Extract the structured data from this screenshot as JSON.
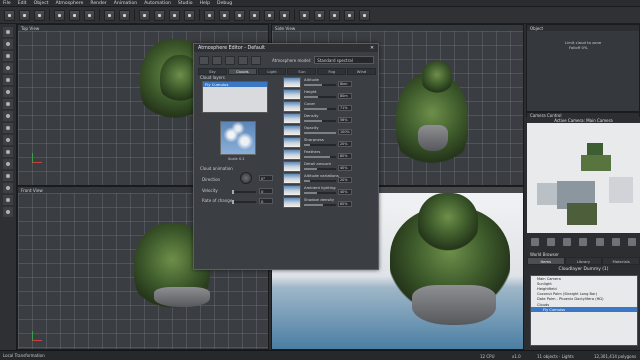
{
  "menu": [
    "File",
    "Edit",
    "Object",
    "Atmosphere",
    "Render",
    "Animation",
    "Automation",
    "Studio",
    "Help",
    "Debug"
  ],
  "viewports": {
    "top": "Top View",
    "side": "Side View",
    "front": "Front View",
    "main_info": "GeForce GTX 1070/PCIe/SSE2 (0) ▸ 4a"
  },
  "atmosphere_editor": {
    "title": "Atmosphere Editor - Default",
    "close": "✕",
    "model_label": "Atmosphere model:",
    "model_value": "Standard spectral",
    "tabs": [
      "Sky",
      "Clouds",
      "Light",
      "Sun",
      "Fog",
      "Wind"
    ],
    "active_tab": "Clouds",
    "cloud_layers_label": "Cloud layers",
    "layer_item": "Fly Cumulus",
    "scale_label": "Scale",
    "scale_value": "0.2",
    "cloud_animation_label": "Cloud animation",
    "direction_label": "Direction",
    "direction_value": "0°",
    "velocity_label": "Velocity",
    "velocity_value": "0",
    "rate_label": "Rate of change",
    "rate_value": "0",
    "params": [
      {
        "label": "Altitude",
        "value": "8km",
        "fill": 0.55
      },
      {
        "label": "Height",
        "value": "80m",
        "fill": 0.45
      },
      {
        "label": "Cover",
        "value": "71%",
        "fill": 0.71
      },
      {
        "label": "Density",
        "value": "56%",
        "fill": 0.56
      },
      {
        "label": "Opacity",
        "value": "100%",
        "fill": 1.0
      },
      {
        "label": "Sharpness",
        "value": "20%",
        "fill": 0.2
      },
      {
        "label": "Feathers",
        "value": "80%",
        "fill": 0.8
      },
      {
        "label": "Detail amount",
        "value": "40%",
        "fill": 0.4
      },
      {
        "label": "Altitude variations",
        "value": "20%",
        "fill": 0.2
      },
      {
        "label": "Ambient lighting",
        "value": "40%",
        "fill": 0.4
      },
      {
        "label": "Shadow density",
        "value": "60%",
        "fill": 0.6
      }
    ]
  },
  "right_panel": {
    "object_title": "Object",
    "limit_cloud": "Limit cloud to zone",
    "falloff_label": "Falloff",
    "falloff_value": "0%",
    "camera_control": "Camera Control",
    "camera_title": "Active Camera: Main Camera",
    "world_browser": "World Browser",
    "wb_tabs": [
      "Items",
      "Library",
      "Materials"
    ],
    "wb_active": "Items",
    "wb_scene": "Cloudlayer Dummy (1)",
    "tree": [
      "Main Camera",
      "Sunlight",
      "Heightfield",
      "Coconut Palm (Straight Long Bar)",
      "Date Palm - Phoenix Dactylifera (HD)",
      "Clouds",
      "Fly Cumulus"
    ],
    "tree_selected": "Fly Cumulus"
  },
  "status": {
    "left": "Local Transformation",
    "mid": "12 CPU",
    "zoom": "x1.0",
    "objects": "11 objects · Lights",
    "polys": "12,301,414 polygons"
  },
  "colors": {
    "selection": "#3a78c6",
    "axis_x": "#c8403b",
    "axis_y": "#3aa04a"
  }
}
